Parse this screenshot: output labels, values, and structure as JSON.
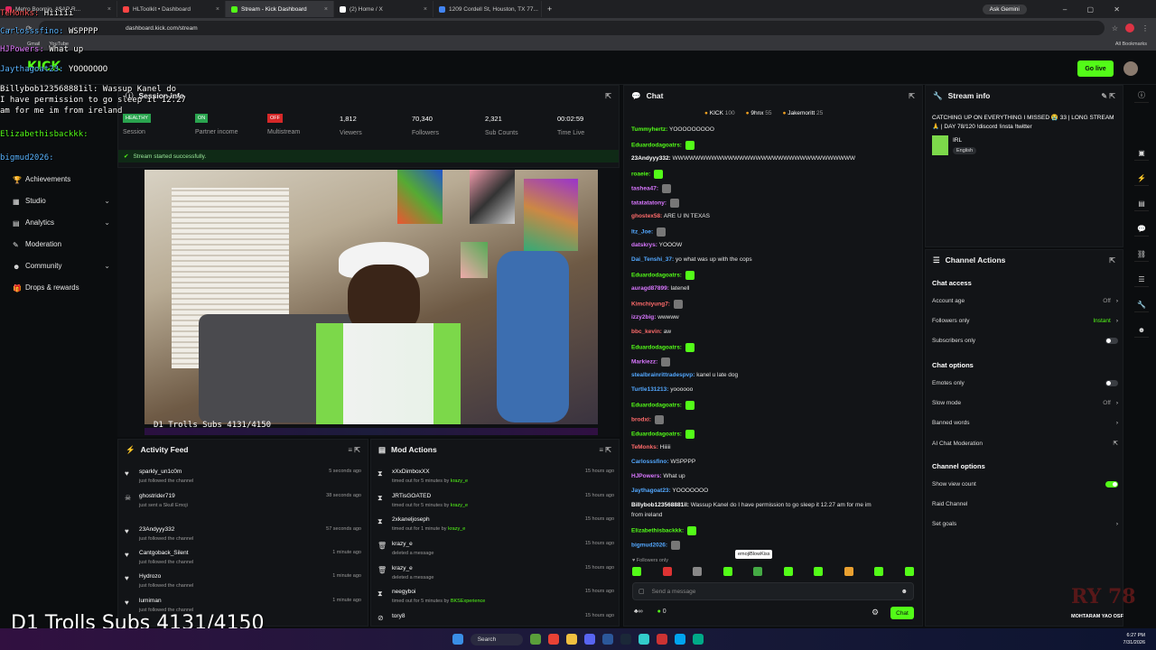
{
  "browser": {
    "tabs": [
      {
        "title": "Metro Boomin, A$AP R...",
        "color": "#e0245e"
      },
      {
        "title": "HLToolkit • Dashboard",
        "color": "#ff4444"
      },
      {
        "title": "Stream - Kick Dashboard",
        "color": "#53fc18",
        "active": true
      },
      {
        "title": "(2) Home / X",
        "color": "#ffffff"
      },
      {
        "title": "1209 Cordell St, Houston, TX 77...",
        "color": "#4285f4"
      }
    ],
    "ask_gemini": "Ask Gemini",
    "url": "dashboard.kick.com/stream",
    "bookmarks": [
      "Gmail",
      "YouTube"
    ],
    "all_bookmarks": "All Bookmarks"
  },
  "header": {
    "go_live": "Go live"
  },
  "sidebar": {
    "items": [
      {
        "label": "Achievements",
        "chev": ""
      },
      {
        "label": "Studio",
        "chev": "⌄"
      },
      {
        "label": "Analytics",
        "chev": "⌄"
      },
      {
        "label": "Moderation",
        "chev": ""
      },
      {
        "label": "Community",
        "chev": "⌄"
      },
      {
        "label": "Drops & rewards",
        "chev": ""
      }
    ]
  },
  "session": {
    "title": "Session info",
    "stats": [
      {
        "badge": "HEALTHY",
        "label": "Session",
        "color": "#2aa44f"
      },
      {
        "badge": "ON",
        "label": "Partner income",
        "color": "#2aa44f"
      },
      {
        "badge": "OFF",
        "label": "Multistream",
        "color": "#d62828"
      },
      {
        "value": "1,812",
        "label": "Viewers"
      },
      {
        "value": "70,340",
        "label": "Followers"
      },
      {
        "value": "2,321",
        "label": "Sub Counts"
      },
      {
        "value": "00:02:59",
        "label": "Time Live"
      }
    ],
    "status": "Stream started successfully."
  },
  "video": {
    "subs_caption": "D1 Trolls Subs 4131/4150"
  },
  "activity": {
    "title": "Activity Feed",
    "items": [
      {
        "name": "sparkly_un1c0m",
        "sub": "just followed the channel",
        "time": "5 seconds ago"
      },
      {
        "name": "ghostrider719",
        "sub": "just sent a Skull Emoji",
        "time": "38 seconds ago"
      },
      {
        "name": "23Andyyy332",
        "sub": "just followed the channel",
        "time": "57 seconds ago"
      },
      {
        "name": "Cantgoback_Silent",
        "sub": "just followed the channel",
        "time": "1 minute ago"
      },
      {
        "name": "Hydrozo",
        "sub": "just followed the channel",
        "time": "1 minute ago"
      },
      {
        "name": "lumiman",
        "sub": "just followed the channel",
        "time": "1 minute ago"
      }
    ]
  },
  "mod": {
    "title": "Mod Actions",
    "items": [
      {
        "name": "xXxDimboxXX",
        "sub": "timed out for 5 minutes by",
        "by": "krazy_e",
        "time": "15 hours ago"
      },
      {
        "name": "JRTisGOATED",
        "sub": "timed out for 5 minutes by",
        "by": "krazy_e",
        "time": "15 hours ago"
      },
      {
        "name": "2xkaneljoseph",
        "sub": "timed out for 1 minute by",
        "by": "krazy_e",
        "time": "15 hours ago"
      },
      {
        "name": "krazy_e",
        "sub": "deleted a message",
        "by": "",
        "time": "15 hours ago"
      },
      {
        "name": "krazy_e",
        "sub": "deleted a message",
        "by": "",
        "time": "15 hours ago"
      },
      {
        "name": "neegyboi",
        "sub": "timed out for 5 minutes by",
        "by": "BKSExperience",
        "time": "15 hours ago"
      },
      {
        "name": "tory8",
        "sub": "",
        "by": "",
        "time": "15 hours ago"
      }
    ]
  },
  "chat": {
    "title": "Chat",
    "leaders": [
      {
        "name": "KICK",
        "n": "100"
      },
      {
        "name": "9hnx",
        "n": "55"
      },
      {
        "name": "Jakemoritt",
        "n": "25"
      }
    ],
    "messages": [
      {
        "user": "Tummyhertz:",
        "text": "YOOOOOOOOO",
        "color": "#53fc18"
      },
      {
        "user": "Eduardodagoatrs:",
        "text": "",
        "color": "#53fc18"
      },
      {
        "user": "23Andyyy332:",
        "text": "WWWWWWWWWWWWWWWWWWWWWWWWWWWWWWWWW",
        "color": "#ffffff"
      },
      {
        "user": "roaeie:",
        "text": "",
        "color": "#53fc18"
      },
      {
        "user": "tashea47:",
        "text": "",
        "color": "#d977ff"
      },
      {
        "user": "tatatatatony:",
        "text": "",
        "color": "#d977ff"
      },
      {
        "user": "ghostex58:",
        "text": "ARE U IN TEXAS",
        "color": "#ff6b6b"
      },
      {
        "user": "Itz_Joe:",
        "text": "",
        "color": "#53a8ff"
      },
      {
        "user": "datskrys:",
        "text": "YOOOW",
        "color": "#d977ff"
      },
      {
        "user": "Dai_Tenshi_37:",
        "text": "yo what was up with the cops",
        "color": "#53a8ff"
      },
      {
        "user": "Eduardodagoatrs:",
        "text": "",
        "color": "#53fc18"
      },
      {
        "user": "auragd87899:",
        "text": "latenell",
        "color": "#d977ff"
      },
      {
        "user": "Kimchiyung7:",
        "text": "",
        "color": "#ff6b6b"
      },
      {
        "user": "izzy2big:",
        "text": "wwwww",
        "color": "#d977ff"
      },
      {
        "user": "bbc_kevin:",
        "text": "aw",
        "color": "#ff6b6b"
      },
      {
        "user": "Eduardodagoatrs:",
        "text": "",
        "color": "#53fc18"
      },
      {
        "user": "Markiezz:",
        "text": "",
        "color": "#d977ff"
      },
      {
        "user": "stealbrainrittradespvp:",
        "text": "kanel u late dog",
        "color": "#53a8ff"
      },
      {
        "user": "Turtle131213:",
        "text": "yoooooo",
        "color": "#53a8ff"
      },
      {
        "user": "Eduardodagoatrs:",
        "text": "",
        "color": "#53fc18"
      },
      {
        "user": "brodxi:",
        "text": "",
        "color": "#ff6b6b"
      },
      {
        "user": "Eduardodagoatrs:",
        "text": "",
        "color": "#53fc18"
      },
      {
        "user": "TeMonks:",
        "text": "Hiiiii",
        "color": "#ff6b6b"
      },
      {
        "user": "Carlosssfino:",
        "text": "WSPPPP",
        "color": "#53a8ff"
      },
      {
        "user": "HJPowers:",
        "text": "What up",
        "color": "#d977ff"
      },
      {
        "user": "Jaythagoat23:",
        "text": "YOOOOOOO",
        "color": "#53a8ff"
      },
      {
        "user": "Billybob123568881il:",
        "text": "Wassup Kanel do I have permission to go sleep it 12.27 am for me im",
        "color": "#ffffff"
      },
      {
        "user": "",
        "text": "from ireland",
        "color": "#ffffff"
      },
      {
        "user": "Elizabethisbackkk:",
        "text": "",
        "color": "#53fc18"
      },
      {
        "user": "bigmud2026:",
        "text": "",
        "color": "#53a8ff"
      }
    ],
    "tooltip": "emojiBlowKiss",
    "followers_only": "Followers only",
    "placeholder": "Send a message",
    "viewers": "0",
    "send_label": "Chat"
  },
  "streaminfo": {
    "title": "Stream info",
    "stream_title": "CATCHING UP ON EVERYTHING I MISSED 😭 33 | LONG STREAM 🙏 | DAY 78/120 !discord !insta !twitter",
    "category": "IRL",
    "language": "English"
  },
  "channel": {
    "title": "Channel Actions",
    "chat_access": "Chat access",
    "account_age": {
      "label": "Account age",
      "value": "Off"
    },
    "followers_only": {
      "label": "Followers only",
      "value": "Instant"
    },
    "subscribers_only": "Subscribers only",
    "chat_options": "Chat options",
    "emotes_only": "Emotes only",
    "slow_mode": {
      "label": "Slow mode",
      "value": "Off"
    },
    "banned_words": "Banned words",
    "ai_mod": "AI Chat Moderation",
    "channel_options": "Channel options",
    "show_view_count": "Show view count",
    "raid_channel": "Raid Channel",
    "set_goals": "Set goals"
  },
  "overlay": {
    "lines": [
      {
        "user": "TeMonks:",
        "text": "Hiiiii",
        "color": "#ff5a5a"
      },
      {
        "user": "Carlosssfino:",
        "text": "WSPPPP",
        "color": "#5ab4ff"
      },
      {
        "user": "HJPowers:",
        "text": "What up",
        "color": "#e27bff"
      },
      {
        "user": "Jaythagoat23:",
        "text": "YOOOOOOO",
        "color": "#5ab4ff"
      },
      {
        "user": "Billybob123568881il:",
        "text": "Wassup Kanel do",
        "color": "#ffffff"
      },
      {
        "user": "",
        "text": "I have permission to go sleep it 12.27",
        "color": "#ffffff"
      },
      {
        "user": "",
        "text": "am for me im from ireland",
        "color": "#ffffff"
      },
      {
        "user": "Elizabethisbackkk:",
        "text": "",
        "color": "#53fc18"
      },
      {
        "user": "bigmud2026:",
        "text": "",
        "color": "#5ab4ff"
      }
    ],
    "subs_big": "D1 Trolls Subs 4131/4150",
    "watermark": "MOHTARAM YAO OSF"
  },
  "taskbar": {
    "search": "Search",
    "time": "6:27 PM",
    "date": "7/31/2026"
  }
}
